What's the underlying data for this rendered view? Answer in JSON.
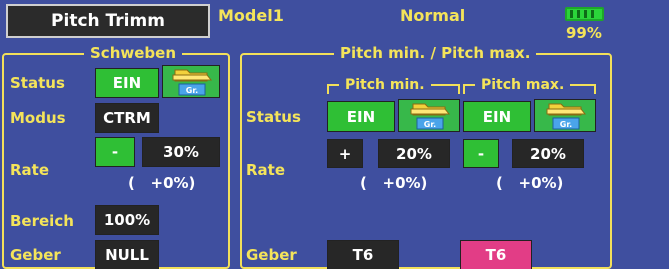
{
  "header": {
    "title_button": "Pitch Trimm",
    "model": "Model1",
    "condition": "Normal",
    "battery_percent": "99%"
  },
  "schweben": {
    "title": "Schweben",
    "status_label": "Status",
    "status_value": "EIN",
    "status_group": "Gr.",
    "modus_label": "Modus",
    "modus_value": "CTRM",
    "rate_label": "Rate",
    "rate_sign": "-",
    "rate_value": "30%",
    "rate_offset": "(   +0%)",
    "bereich_label": "Bereich",
    "bereich_value": "100%",
    "geber_label": "Geber",
    "geber_value": "NULL"
  },
  "pitch": {
    "title": "Pitch min. / Pitch max.",
    "status_label": "Status",
    "rate_label": "Rate",
    "geber_label": "Geber",
    "min": {
      "title": "Pitch min.",
      "status_value": "EIN",
      "status_group": "Gr.",
      "rate_sign": "+",
      "rate_value": "20%",
      "rate_offset": "(   +0%)",
      "geber_value": "T6"
    },
    "max": {
      "title": "Pitch max.",
      "status_value": "EIN",
      "status_group": "Gr.",
      "rate_sign": "-",
      "rate_value": "20%",
      "rate_offset": "(   +0%)",
      "geber_value": "T6"
    }
  },
  "colors": {
    "background": "#3f4f9f",
    "label_yellow": "#f4e45a",
    "on_green": "#2fbf35",
    "button_dark": "#272727",
    "selected_magenta": "#e23d86"
  },
  "icons": {
    "group": "folder-group-icon",
    "battery": "battery-icon"
  }
}
